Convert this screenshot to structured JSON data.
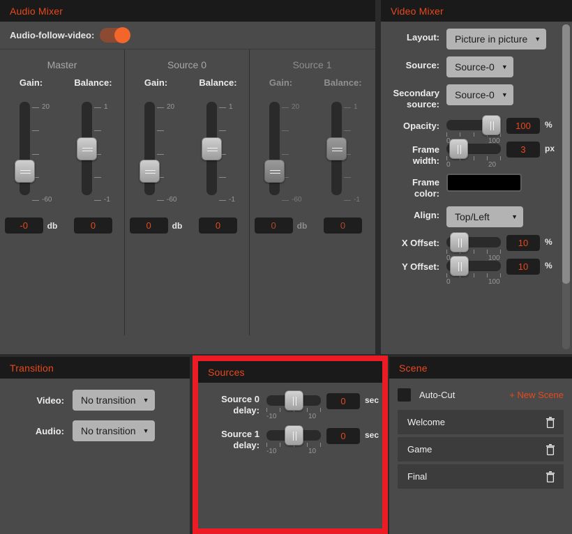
{
  "audio_mixer": {
    "title": "Audio Mixer",
    "afv_label": "Audio-follow-video:",
    "afv_state": "on",
    "columns": [
      {
        "name": "Master",
        "enabled": true,
        "gain": {
          "label": "Gain:",
          "value": "-0",
          "unit": "db",
          "min_label": "-60",
          "max_label": "20",
          "handle_pct": 18
        },
        "balance": {
          "label": "Balance:",
          "value": "0",
          "unit": "",
          "min_label": "-1",
          "max_label": "1",
          "handle_pct": 50
        }
      },
      {
        "name": "Source 0",
        "enabled": true,
        "gain": {
          "label": "Gain:",
          "value": "0",
          "unit": "db",
          "min_label": "-60",
          "max_label": "20",
          "handle_pct": 18
        },
        "balance": {
          "label": "Balance:",
          "value": "0",
          "unit": "",
          "min_label": "-1",
          "max_label": "1",
          "handle_pct": 50
        }
      },
      {
        "name": "Source 1",
        "enabled": false,
        "gain": {
          "label": "Gain:",
          "value": "0",
          "unit": "db",
          "min_label": "-60",
          "max_label": "20",
          "handle_pct": 18
        },
        "balance": {
          "label": "Balance:",
          "value": "0",
          "unit": "",
          "min_label": "-1",
          "max_label": "1",
          "handle_pct": 50
        }
      }
    ]
  },
  "video_mixer": {
    "title": "Video Mixer",
    "layout": {
      "label": "Layout:",
      "value": "Picture in picture"
    },
    "source": {
      "label": "Source:",
      "value": "Source-0"
    },
    "secondary_source": {
      "label_line1": "Secondary",
      "label_line2": "source:",
      "value": "Source-0"
    },
    "opacity": {
      "label": "Opacity:",
      "value": "100",
      "unit": "%",
      "min_label": "0",
      "max_label": "100",
      "handle_pct": 100
    },
    "frame_width": {
      "label_line1": "Frame",
      "label_line2": "width:",
      "value": "3",
      "unit": "px",
      "min_label": "0",
      "max_label": "20",
      "handle_pct": 8
    },
    "frame_color": {
      "label_line1": "Frame",
      "label_line2": "color:",
      "color": "#000000"
    },
    "align": {
      "label": "Align:",
      "value": "Top/Left"
    },
    "x_offset": {
      "label": "X Offset:",
      "value": "10",
      "unit": "%",
      "min_label": "0",
      "max_label": "100",
      "handle_pct": 10
    },
    "y_offset": {
      "label": "Y Offset:",
      "value": "10",
      "unit": "%",
      "min_label": "0",
      "max_label": "100",
      "handle_pct": 10
    }
  },
  "transition": {
    "title": "Transition",
    "video": {
      "label": "Video:",
      "value": "No transition"
    },
    "audio": {
      "label": "Audio:",
      "value": "No transition"
    }
  },
  "sources": {
    "title": "Sources",
    "highlight_color": "#ed1c24",
    "rows": [
      {
        "label_line1": "Source 0",
        "label_line2": "delay:",
        "value": "0",
        "unit": "sec",
        "min_label": "-10",
        "max_label": "10",
        "handle_pct": 50
      },
      {
        "label_line1": "Source 1",
        "label_line2": "delay:",
        "value": "0",
        "unit": "sec",
        "min_label": "-10",
        "max_label": "10",
        "handle_pct": 50
      }
    ]
  },
  "scene": {
    "title": "Scene",
    "autocut_label": "Auto-Cut",
    "autocut_checked": false,
    "new_scene_label": "+ New Scene",
    "items": [
      {
        "name": "Welcome"
      },
      {
        "name": "Game"
      },
      {
        "name": "Final"
      }
    ]
  },
  "colors": {
    "accent": "#e8491d",
    "header_bg": "#1a1a1a",
    "panel_bg": "#4a4a4a",
    "highlight": "#ed1c24"
  }
}
